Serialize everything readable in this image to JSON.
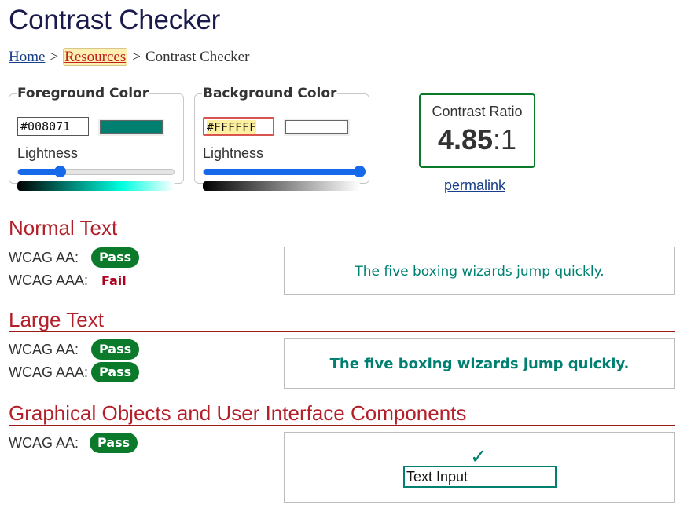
{
  "page": {
    "title": "Contrast Checker"
  },
  "breadcrumb": {
    "home": "Home",
    "sep1": ">",
    "resources": "Resources",
    "sep2": ">",
    "current": "Contrast Checker"
  },
  "foreground": {
    "legend": "Foreground Color",
    "hex": "#008071",
    "swatch_color": "#008071",
    "lightness_label": "Lightness",
    "lightness_value": 0.27,
    "gradient": [
      "#000000",
      "#008071",
      "#00ffe0",
      "#ffffff"
    ]
  },
  "background": {
    "legend": "Background Color",
    "hex": "#FFFFFF",
    "swatch_color": "#FFFFFF",
    "lightness_label": "Lightness",
    "lightness_value": 1.0,
    "gradient": [
      "#000000",
      "#ffffff"
    ]
  },
  "ratio": {
    "label": "Contrast Ratio",
    "value_bold": "4.85",
    "value_rest": ":1",
    "permalink": "permalink"
  },
  "normal": {
    "heading": "Normal Text",
    "aa_label": "WCAG AA:",
    "aa_result": "Pass",
    "aaa_label": "WCAG AAA:",
    "aaa_result": "Fail",
    "sample": "The five boxing wizards jump quickly."
  },
  "large": {
    "heading": "Large Text",
    "aa_label": "WCAG AA:",
    "aa_result": "Pass",
    "aaa_label": "WCAG AAA:",
    "aaa_result": "Pass",
    "sample": "The five boxing wizards jump quickly."
  },
  "graphical": {
    "heading": "Graphical Objects and User Interface Components",
    "aa_label": "WCAG AA:",
    "aa_result": "Pass",
    "check_icon": "check-icon",
    "input_value": "Text Input"
  },
  "colors": {
    "pass": "#0b7a2b",
    "fail": "#b00020",
    "heading": "#b3202a",
    "accent": "#1669e8"
  }
}
